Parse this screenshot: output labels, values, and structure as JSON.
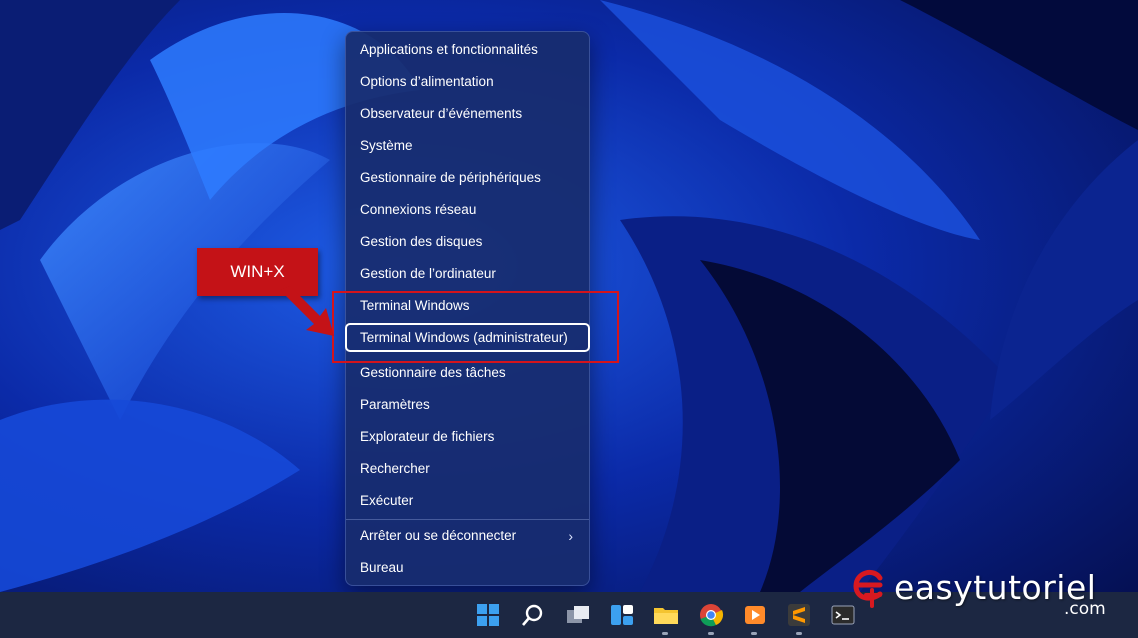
{
  "menu": {
    "items": [
      {
        "label": "Applications et fonctionnalités",
        "name": "menu-item-apps-features"
      },
      {
        "label": "Options d’alimentation",
        "name": "menu-item-power-options"
      },
      {
        "label": "Observateur d’événements",
        "name": "menu-item-event-viewer"
      },
      {
        "label": "Système",
        "name": "menu-item-system"
      },
      {
        "label": "Gestionnaire de périphériques",
        "name": "menu-item-device-manager"
      },
      {
        "label": "Connexions réseau",
        "name": "menu-item-network-connections"
      },
      {
        "label": "Gestion des disques",
        "name": "menu-item-disk-management"
      },
      {
        "label": "Gestion de l’ordinateur",
        "name": "menu-item-computer-management"
      },
      {
        "label": "Terminal Windows",
        "name": "menu-item-terminal"
      },
      {
        "label": "Terminal Windows (administrateur)",
        "name": "menu-item-terminal-admin"
      },
      {
        "label": "Gestionnaire des tâches",
        "name": "menu-item-task-manager"
      },
      {
        "label": "Paramètres",
        "name": "menu-item-settings"
      },
      {
        "label": "Explorateur de fichiers",
        "name": "menu-item-file-explorer"
      },
      {
        "label": "Rechercher",
        "name": "menu-item-search"
      },
      {
        "label": "Exécuter",
        "name": "menu-item-run"
      },
      {
        "label": "Arrêter ou se déconnecter",
        "name": "menu-item-shutdown"
      },
      {
        "label": "Bureau",
        "name": "menu-item-desktop"
      }
    ],
    "focused_label": "Terminal Windows (administrateur)"
  },
  "callout": {
    "label": "WIN+X"
  },
  "watermark": {
    "name": "easytutoriel",
    "tld": ".com"
  },
  "taskbar": {
    "icons": [
      "windows-start-icon",
      "search-icon",
      "task-view-icon",
      "widgets-icon",
      "file-explorer-icon",
      "chrome-icon",
      "media-player-icon",
      "sublime-text-icon",
      "terminal-icon"
    ]
  },
  "colors": {
    "accent": "#c41217",
    "menu_bg": "#182c6e",
    "taskbar_bg": "#1c2742"
  }
}
